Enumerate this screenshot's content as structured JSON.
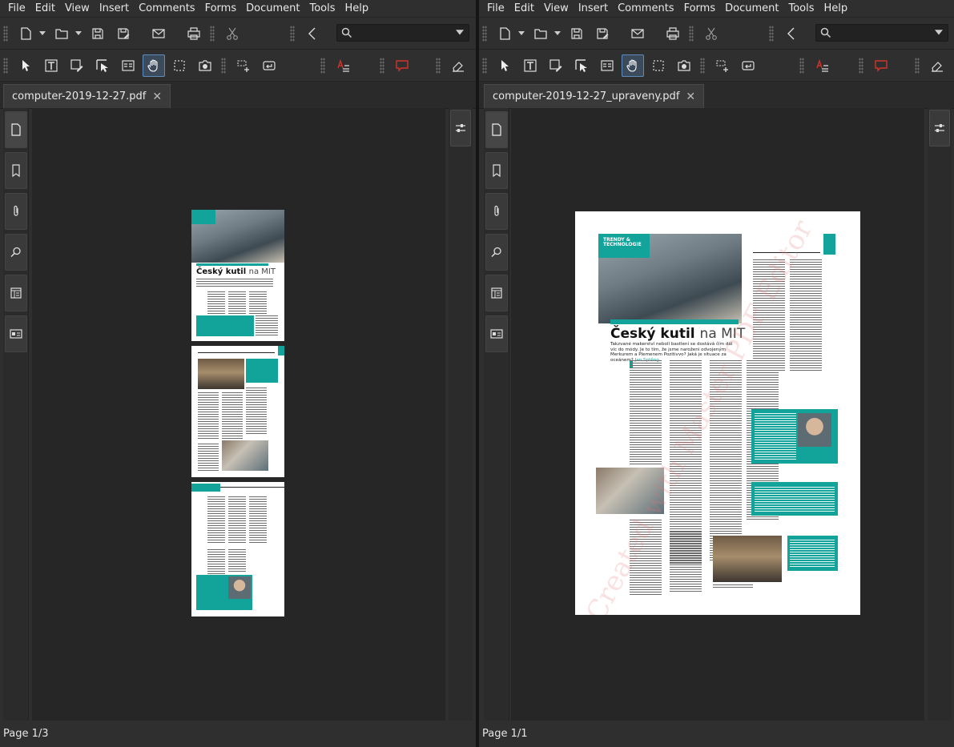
{
  "menu": [
    "File",
    "Edit",
    "View",
    "Insert",
    "Comments",
    "Forms",
    "Document",
    "Tools",
    "Help"
  ],
  "left": {
    "tab_title": "computer-2019-12-27.pdf",
    "status": "Page 1/3",
    "search_placeholder": ""
  },
  "right": {
    "tab_title": "computer-2019-12-27_upraveny.pdf",
    "status": "Page 1/1",
    "search_placeholder": ""
  },
  "tab_close": "✕",
  "doc": {
    "tag": "TRENDY & TECHNOLOGIE",
    "headline_bold": "Český kutil",
    "headline_light": "na MIT",
    "subhead": "Takzvané makerství nebolí bastlení se dostává čím dál víc do módy. Je to tím, že jsme naroženi odvojeným Merkurem a Plemenem Pozitivvo? Jaká je situace za oceánem?",
    "author": "Jan Sptěng",
    "watermark": "Created with Master PDF Editor"
  },
  "colors": {
    "accent_teal": "#12a39a",
    "active_tool": "#5c8cbd",
    "annotation_red": "#d0332b"
  }
}
